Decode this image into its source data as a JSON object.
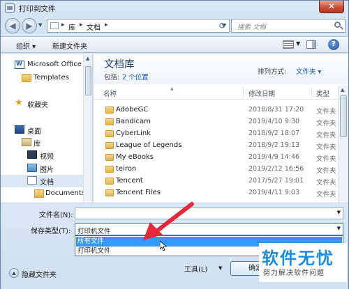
{
  "window": {
    "title": "打印到文件",
    "close_label": "✕"
  },
  "address": {
    "crumbs": [
      "库",
      "文档"
    ],
    "search_placeholder": "搜索 文档"
  },
  "toolbar": {
    "organize_label": "组织 ▾",
    "new_folder_label": "新建文件夹",
    "help_label": "?"
  },
  "sidebar": {
    "items": [
      {
        "label": "Microsoft Office",
        "icon": "word-icon"
      },
      {
        "label": "Templates",
        "icon": "folder-icon"
      },
      {
        "label": "收藏夹",
        "icon": "star-icon"
      },
      {
        "label": "桌面",
        "icon": "desktop-icon"
      },
      {
        "label": "库",
        "icon": "library-icon"
      },
      {
        "label": "视频",
        "icon": "video-icon"
      },
      {
        "label": "图片",
        "icon": "picture-icon"
      },
      {
        "label": "文档",
        "icon": "document-icon"
      },
      {
        "label": "Documents",
        "icon": "folder-icon"
      }
    ]
  },
  "library": {
    "title": "文档库",
    "includes_label": "包括:",
    "locations": "2 个位置",
    "arrange_label": "排列方式:",
    "arrange_value": "文件夹 ▾"
  },
  "columns": {
    "name": "名称",
    "date": "修改日期",
    "type": "类型"
  },
  "files": [
    {
      "name": "AdobeGC",
      "date": "2018/8/31 17:20",
      "type": "文件夹"
    },
    {
      "name": "Bandicam",
      "date": "2019/4/10 9:30",
      "type": "文件夹"
    },
    {
      "name": "CyberLink",
      "date": "2018/9/2 18:07",
      "type": "文件夹"
    },
    {
      "name": "League of Legends",
      "date": "2018/9/2 19:13",
      "type": "文件夹"
    },
    {
      "name": "My eBooks",
      "date": "2019/4/9 14:46",
      "type": "文件夹"
    },
    {
      "name": "teiron",
      "date": "2019/2/12 16:56",
      "type": "文件夹"
    },
    {
      "name": "Tencent",
      "date": "2017/5/27 19:01",
      "type": "文件夹"
    },
    {
      "name": "Tencent Files",
      "date": "2019/4/11 9:03",
      "type": "文件夹"
    }
  ],
  "form": {
    "filename_label": "文件名(N):",
    "filename_value": "",
    "savetype_label": "保存类型(T):",
    "savetype_value": "打印机文件",
    "options": [
      "所有文件",
      "打印机文件"
    ],
    "hide_folders_label": "隐藏文件夹",
    "hide_icon_glyph": "▲",
    "tools_label": "工具(L)",
    "save_label": "确定"
  },
  "watermark": {
    "title": "软件无忧",
    "subtitle": "努力解决软件问题"
  },
  "colors": {
    "accent": "#3399ff",
    "annotation": "#e5283a",
    "watermark": "#1d8ce0"
  }
}
